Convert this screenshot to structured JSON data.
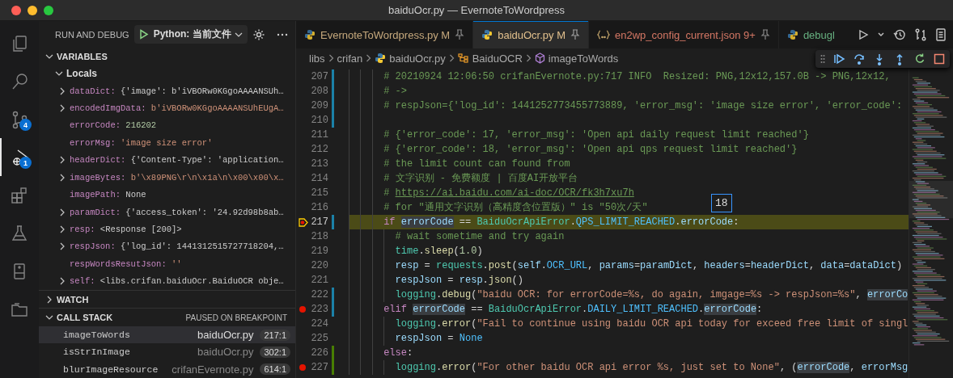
{
  "window": {
    "title": "baiduOcr.py — EvernoteToWordpress"
  },
  "activity_bar": [
    {
      "kind": "files",
      "selected": false
    },
    {
      "kind": "search",
      "selected": false
    },
    {
      "kind": "source-control",
      "selected": false,
      "badge": "4"
    },
    {
      "kind": "debug",
      "selected": true,
      "badge": "1"
    },
    {
      "kind": "extensions",
      "selected": false
    },
    {
      "kind": "testing",
      "selected": false
    },
    {
      "kind": "notebook",
      "selected": false
    },
    {
      "kind": "folder",
      "selected": false
    }
  ],
  "run_panel": {
    "title": "RUN AND DEBUG",
    "configuration": "Python: 当前文件"
  },
  "variables": {
    "title": "VARIABLES",
    "expanded": true,
    "scope": {
      "label": "Locals",
      "expanded": true
    },
    "rows": [
      {
        "name": "dataDict:",
        "value": "{'image': b'iVBORw0KGgoAAAANSUh…",
        "kind": "object",
        "expandable": true
      },
      {
        "name": "encodedImgData:",
        "value": "b'iVBORw0KGgoAAAANSUhEUgA…",
        "kind": "string",
        "expandable": true
      },
      {
        "name": "errorCode:",
        "value": "216202",
        "kind": "number",
        "expandable": false
      },
      {
        "name": "errorMsg:",
        "value": "'image size error'",
        "kind": "string",
        "expandable": false
      },
      {
        "name": "headerDict:",
        "value": "{'Content-Type': 'application…",
        "kind": "object",
        "expandable": true
      },
      {
        "name": "imageBytes:",
        "value": "b'\\x89PNG\\r\\n\\x1a\\n\\x00\\x00\\x…",
        "kind": "string",
        "expandable": true
      },
      {
        "name": "imagePath:",
        "value": "None",
        "kind": "object",
        "expandable": false
      },
      {
        "name": "paramDict:",
        "value": "{'access_token': '24.92d98b8ab…",
        "kind": "object",
        "expandable": true
      },
      {
        "name": "resp:",
        "value": "<Response [200]>",
        "kind": "object",
        "expandable": true
      },
      {
        "name": "respJson:",
        "value": "{'log_id': 1441312515727718204,…",
        "kind": "object",
        "expandable": true
      },
      {
        "name": "respWordsResutJson:",
        "value": "''",
        "kind": "string",
        "expandable": false
      },
      {
        "name": "self:",
        "value": "<libs.crifan.baiduOcr.BaiduOCR obje…",
        "kind": "object",
        "expandable": true
      }
    ]
  },
  "watch": {
    "title": "WATCH",
    "expanded": false
  },
  "call_stack": {
    "title": "CALL STACK",
    "expanded": true,
    "status": "PAUSED ON BREAKPOINT",
    "frames": [
      {
        "function": "imageToWords",
        "file": "baiduOcr.py",
        "position": "217:1",
        "selected": true
      },
      {
        "function": "isStrInImage",
        "file": "baiduOcr.py",
        "position": "302:1",
        "selected": false
      },
      {
        "function": "blurImageResource",
        "file": "crifanEvernote.py",
        "position": "614:1",
        "selected": false
      }
    ]
  },
  "tabs": [
    {
      "label": "EvernoteToWordpress.py",
      "kind": "python",
      "status": "M",
      "pinned": true,
      "selected": false
    },
    {
      "label": "baiduOcr.py",
      "kind": "python",
      "status": "M",
      "pinned": true,
      "selected": true
    },
    {
      "label": "en2wp_config_current.json",
      "kind": "json",
      "status": "9+",
      "pinned": true,
      "selected": false
    },
    {
      "label": "debugl",
      "kind": "python",
      "pinned": false,
      "selected": false
    }
  ],
  "breadcrumb": [
    {
      "label": "libs",
      "kind": "folder"
    },
    {
      "label": "crifan",
      "kind": "folder"
    },
    {
      "label": "baiduOcr.py",
      "kind": "python"
    },
    {
      "label": "BaiduOCR",
      "kind": "class"
    },
    {
      "label": "imageToWords",
      "kind": "method"
    }
  ],
  "hover": {
    "text": "18"
  },
  "code": [
    {
      "number": "207",
      "inner": false,
      "kind": "modified",
      "breakpoint": false,
      "current": false,
      "tokens": [
        {
          "kind": "comment",
          "text": "# 20210924 12:06:50 crifanEvernote.py:717 INFO  Resized: PNG,12x12,157.0B -> PNG,12x12,"
        }
      ]
    },
    {
      "number": "208",
      "inner": false,
      "kind": "modified",
      "breakpoint": false,
      "current": false,
      "tokens": [
        {
          "kind": "comment",
          "text": "# ->"
        }
      ]
    },
    {
      "number": "209",
      "inner": false,
      "kind": "modified",
      "breakpoint": false,
      "current": false,
      "tokens": [
        {
          "kind": "comment",
          "text": "# respJson={'log_id': 1441252773455773889, 'error_msg': 'image size error', 'error_code':"
        }
      ]
    },
    {
      "number": "210",
      "inner": false,
      "kind": "modified",
      "breakpoint": false,
      "current": false
    },
    {
      "number": "211",
      "inner": false,
      "kind": "unchanged",
      "breakpoint": false,
      "current": false,
      "tokens": [
        {
          "kind": "comment",
          "text": "# {'error_code': 17, 'error_msg': 'Open api daily request limit reached'}"
        }
      ]
    },
    {
      "number": "212",
      "inner": false,
      "kind": "unchanged",
      "breakpoint": false,
      "current": false,
      "tokens": [
        {
          "kind": "comment",
          "text": "# {'error_code': 18, 'error_msg': 'Open api qps request limit reached'}"
        }
      ]
    },
    {
      "number": "213",
      "inner": false,
      "kind": "unchanged",
      "breakpoint": false,
      "current": false,
      "tokens": [
        {
          "kind": "comment",
          "text": "# the limit count can found from"
        }
      ]
    },
    {
      "number": "214",
      "inner": false,
      "kind": "unchanged",
      "breakpoint": false,
      "current": false,
      "tokens": [
        {
          "kind": "comment",
          "text": "# 文字识别 - 免费额度 | 百度AI开放平台"
        }
      ]
    },
    {
      "number": "215",
      "inner": false,
      "kind": "unchanged",
      "breakpoint": false,
      "current": false,
      "tokens": [
        {
          "kind": "comment",
          "text": "# "
        },
        {
          "kind": "link",
          "text": "https://ai.baidu.com/ai-doc/OCR/fk3h7xu7h"
        }
      ]
    },
    {
      "number": "216",
      "inner": false,
      "kind": "unchanged",
      "breakpoint": false,
      "current": false,
      "tokens": [
        {
          "kind": "comment",
          "text": "# for \"通用文字识别（高精度含位置版）\" is \"50次/天\""
        }
      ]
    },
    {
      "number": "217",
      "inner": false,
      "kind": "modified",
      "breakpoint": true,
      "current": true,
      "tokens": [
        {
          "kind": "keyword",
          "text": "if "
        },
        {
          "kind": "highlight",
          "text": "errorCode"
        },
        {
          "kind": "plain",
          "text": " == "
        },
        {
          "kind": "class",
          "text": "BaiduOcrApiError"
        },
        {
          "kind": "plain",
          "text": "."
        },
        {
          "kind": "constant",
          "text": "QPS_LIMIT_REACHED"
        },
        {
          "kind": "plain",
          "text": "."
        },
        {
          "kind": "variable",
          "text": "errorCode"
        },
        {
          "kind": "plain",
          "text": ":"
        }
      ]
    },
    {
      "number": "218",
      "inner": true,
      "kind": "unchanged",
      "breakpoint": false,
      "current": false,
      "tokens": [
        {
          "kind": "comment",
          "text": "# wait sometime and try again"
        }
      ]
    },
    {
      "number": "219",
      "inner": true,
      "kind": "unchanged",
      "breakpoint": false,
      "current": false,
      "tokens": [
        {
          "kind": "class",
          "text": "time"
        },
        {
          "kind": "plain",
          "text": "."
        },
        {
          "kind": "function",
          "text": "sleep"
        },
        {
          "kind": "plain",
          "text": "("
        },
        {
          "kind": "number",
          "text": "1.0"
        },
        {
          "kind": "plain",
          "text": ")"
        }
      ]
    },
    {
      "number": "220",
      "inner": true,
      "kind": "unchanged",
      "breakpoint": false,
      "current": false,
      "tokens": [
        {
          "kind": "variable",
          "text": "resp"
        },
        {
          "kind": "plain",
          "text": " = "
        },
        {
          "kind": "class",
          "text": "requests"
        },
        {
          "kind": "plain",
          "text": "."
        },
        {
          "kind": "function",
          "text": "post"
        },
        {
          "kind": "plain",
          "text": "("
        },
        {
          "kind": "variable",
          "text": "self"
        },
        {
          "kind": "plain",
          "text": "."
        },
        {
          "kind": "constant",
          "text": "OCR_URL"
        },
        {
          "kind": "plain",
          "text": ", "
        },
        {
          "kind": "variable",
          "text": "params"
        },
        {
          "kind": "plain",
          "text": "="
        },
        {
          "kind": "variable",
          "text": "paramDict"
        },
        {
          "kind": "plain",
          "text": ", "
        },
        {
          "kind": "variable",
          "text": "headers"
        },
        {
          "kind": "plain",
          "text": "="
        },
        {
          "kind": "variable",
          "text": "headerDict"
        },
        {
          "kind": "plain",
          "text": ", "
        },
        {
          "kind": "variable",
          "text": "data"
        },
        {
          "kind": "plain",
          "text": "="
        },
        {
          "kind": "variable",
          "text": "dataDict"
        },
        {
          "kind": "plain",
          "text": ")"
        }
      ]
    },
    {
      "number": "221",
      "inner": true,
      "kind": "unchanged",
      "breakpoint": false,
      "current": false,
      "tokens": [
        {
          "kind": "variable",
          "text": "respJson"
        },
        {
          "kind": "plain",
          "text": " = "
        },
        {
          "kind": "variable",
          "text": "resp"
        },
        {
          "kind": "plain",
          "text": "."
        },
        {
          "kind": "function",
          "text": "json"
        },
        {
          "kind": "plain",
          "text": "()"
        }
      ]
    },
    {
      "number": "222",
      "inner": true,
      "kind": "modified",
      "breakpoint": false,
      "current": false,
      "tokens": [
        {
          "kind": "class",
          "text": "logging"
        },
        {
          "kind": "plain",
          "text": "."
        },
        {
          "kind": "function",
          "text": "debug"
        },
        {
          "kind": "plain",
          "text": "("
        },
        {
          "kind": "string",
          "text": "\"baidu OCR: for errorCode=%s, do again, imgage=%s -> respJson=%s\""
        },
        {
          "kind": "plain",
          "text": ", "
        },
        {
          "kind": "highlight",
          "text": "errorCo"
        }
      ]
    },
    {
      "number": "223",
      "inner": false,
      "kind": "modified",
      "breakpoint": true,
      "current": false,
      "tokens": [
        {
          "kind": "keyword",
          "text": "elif "
        },
        {
          "kind": "highlight",
          "text": "errorCode"
        },
        {
          "kind": "plain",
          "text": " == "
        },
        {
          "kind": "class",
          "text": "BaiduOcrApiError"
        },
        {
          "kind": "plain",
          "text": "."
        },
        {
          "kind": "constant",
          "text": "DAILY_LIMIT_REACHED"
        },
        {
          "kind": "plain",
          "text": "."
        },
        {
          "kind": "highlight",
          "text": "errorCode"
        },
        {
          "kind": "plain",
          "text": ":"
        }
      ]
    },
    {
      "number": "224",
      "inner": true,
      "kind": "unchanged",
      "breakpoint": false,
      "current": false,
      "tokens": [
        {
          "kind": "class",
          "text": "logging"
        },
        {
          "kind": "plain",
          "text": "."
        },
        {
          "kind": "function",
          "text": "error"
        },
        {
          "kind": "plain",
          "text": "("
        },
        {
          "kind": "string",
          "text": "\"Fail to continue using baidu OCR api today for exceed free limit of singl"
        }
      ]
    },
    {
      "number": "225",
      "inner": true,
      "kind": "unchanged",
      "breakpoint": false,
      "current": false,
      "tokens": [
        {
          "kind": "variable",
          "text": "respJson"
        },
        {
          "kind": "plain",
          "text": " = "
        },
        {
          "kind": "constant",
          "text": "None"
        }
      ]
    },
    {
      "number": "226",
      "inner": false,
      "kind": "added",
      "breakpoint": false,
      "current": false,
      "tokens": [
        {
          "kind": "keyword",
          "text": "else"
        },
        {
          "kind": "plain",
          "text": ":"
        }
      ]
    },
    {
      "number": "227",
      "inner": true,
      "kind": "added",
      "breakpoint": true,
      "current": false,
      "tokens": [
        {
          "kind": "class",
          "text": "logging"
        },
        {
          "kind": "plain",
          "text": "."
        },
        {
          "kind": "function",
          "text": "error"
        },
        {
          "kind": "plain",
          "text": "("
        },
        {
          "kind": "string",
          "text": "\"For other baidu OCR api error %s, just set to None\""
        },
        {
          "kind": "plain",
          "text": ", ("
        },
        {
          "kind": "highlight",
          "text": "errorCode"
        },
        {
          "kind": "plain",
          "text": ", "
        },
        {
          "kind": "variable",
          "text": "errorMsg"
        }
      ]
    }
  ]
}
